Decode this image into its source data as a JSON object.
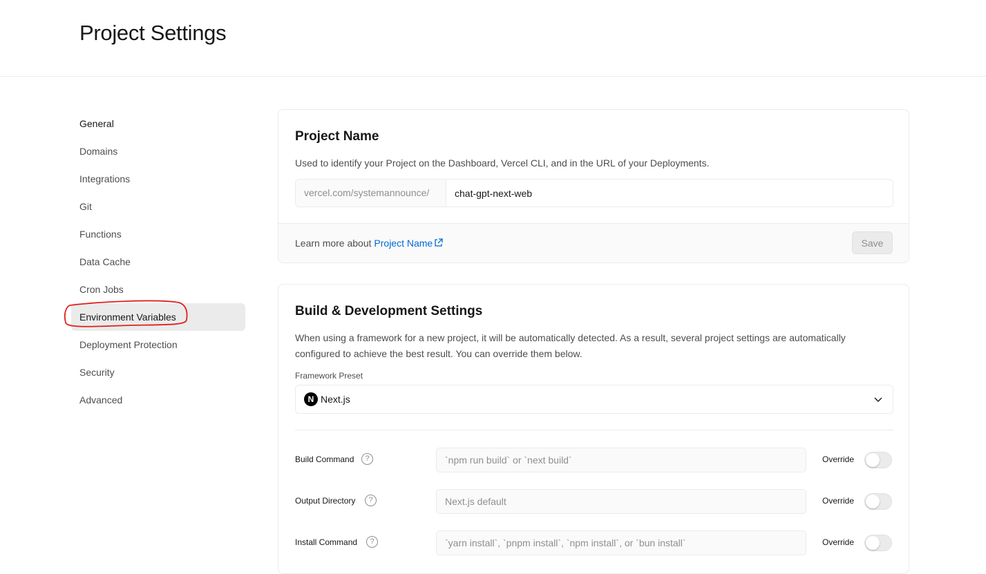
{
  "page": {
    "title": "Project Settings"
  },
  "sidebar": {
    "items": [
      {
        "label": "General"
      },
      {
        "label": "Domains"
      },
      {
        "label": "Integrations"
      },
      {
        "label": "Git"
      },
      {
        "label": "Functions"
      },
      {
        "label": "Data Cache"
      },
      {
        "label": "Cron Jobs"
      },
      {
        "label": "Environment Variables"
      },
      {
        "label": "Deployment Protection"
      },
      {
        "label": "Security"
      },
      {
        "label": "Advanced"
      }
    ],
    "selected": "Environment Variables",
    "annotation_color": "#e0201b"
  },
  "project_name": {
    "title": "Project Name",
    "description": "Used to identify your Project on the Dashboard, Vercel CLI, and in the URL of your Deployments.",
    "prefix": "vercel.com/systemannounce/",
    "value": "chat-gpt-next-web",
    "footer_text": "Learn more about ",
    "footer_link": "Project Name",
    "save_label": "Save"
  },
  "build": {
    "title": "Build & Development Settings",
    "description_line1": "When using a framework for a new project, it will be automatically detected. As a result, several project settings are automatically",
    "description_line2": "configured to achieve the best result. You can override them below.",
    "framework_label": "Framework Preset",
    "framework_value": "Next.js",
    "framework_logo": "N",
    "rows": [
      {
        "label": "Build Command",
        "placeholder": "`npm run build` or `next build`",
        "override": "Override",
        "enabled": false
      },
      {
        "label": "Output Directory",
        "placeholder": "Next.js default",
        "override": "Override",
        "enabled": false
      },
      {
        "label": "Install Command",
        "placeholder": "`yarn install`, `pnpm install`, `npm install`, or `bun install`",
        "override": "Override",
        "enabled": false
      }
    ]
  },
  "colors": {
    "link": "#0068d6",
    "text": "#171717",
    "muted": "#4d4d4d"
  }
}
